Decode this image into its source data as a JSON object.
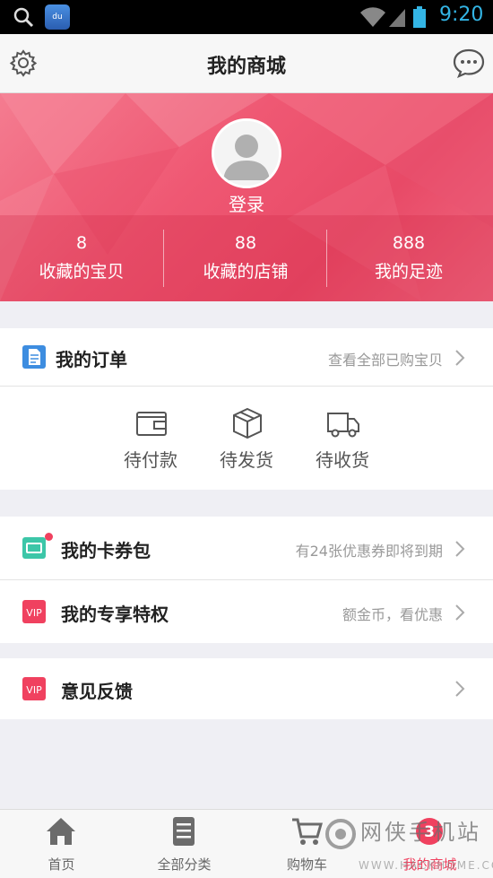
{
  "status_bar": {
    "time": "9:20",
    "app_icon_text": "du"
  },
  "header": {
    "title": "我的商城"
  },
  "profile": {
    "login_label": "登录",
    "stats": [
      {
        "value": "8",
        "label": "收藏的宝贝"
      },
      {
        "value": "88",
        "label": "收藏的店铺"
      },
      {
        "value": "888",
        "label": "我的足迹"
      }
    ]
  },
  "orders": {
    "title": "我的订单",
    "hint": "查看全部已购宝贝",
    "items": [
      {
        "label": "待付款",
        "icon": "wallet-icon"
      },
      {
        "label": "待发货",
        "icon": "package-icon"
      },
      {
        "label": "待收货",
        "icon": "truck-icon"
      }
    ]
  },
  "coupons": {
    "title": "我的卡券包",
    "hint": "有24张优惠券即将到期"
  },
  "privileges": {
    "title": "我的专享特权",
    "hint": "额金币，看优惠",
    "badge": "VIP"
  },
  "feedback": {
    "title": "意见反馈",
    "badge": "VIP"
  },
  "tabbar": {
    "items": [
      {
        "label": "首页",
        "icon": "home-icon"
      },
      {
        "label": "全部分类",
        "icon": "list-icon"
      },
      {
        "label": "购物车",
        "icon": "cart-icon"
      },
      {
        "label": "我的商城",
        "icon": "profile-icon",
        "active": true,
        "badge": "3"
      }
    ]
  },
  "watermark": {
    "text": "网侠手机站",
    "sub": "WWW.HACKHOME.COM"
  },
  "colors": {
    "accent": "#f0415f",
    "banner": "#ef5873",
    "status_blue": "#33b5e5"
  }
}
